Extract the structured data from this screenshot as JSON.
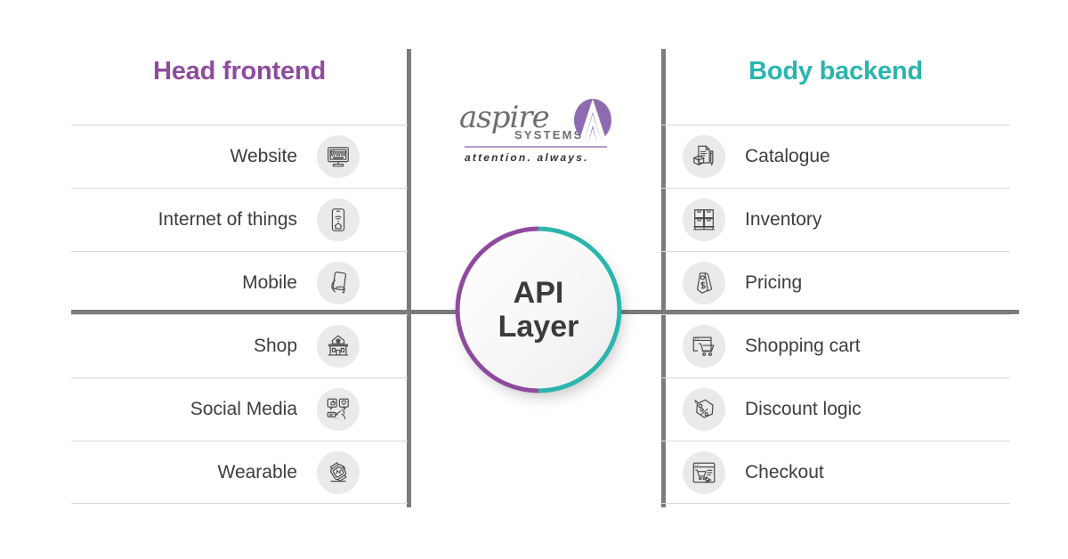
{
  "brand": {
    "logo_word": "aspire",
    "logo_sub": "SYSTEMS",
    "tagline": "attention.  always.",
    "purple": "#8E4B9E",
    "teal": "#2BB5AD",
    "line_gray": "#7b7b7b"
  },
  "center": {
    "title_line1": "API",
    "title_line2": "Layer",
    "ring_left_color": "#8E4B9E",
    "ring_right_color": "#2BB5AD"
  },
  "left_column": {
    "header": "Head frontend",
    "header_color": "#8E4B9E",
    "items": [
      {
        "label": "Website",
        "icon": "monitor-www-icon"
      },
      {
        "label": "Internet of things",
        "icon": "phone-wifi-home-icon"
      },
      {
        "label": "Mobile",
        "icon": "hand-holding-phone-icon"
      },
      {
        "label": "Shop",
        "icon": "storefront-icon"
      },
      {
        "label": "Social Media",
        "icon": "social-reactions-icon"
      },
      {
        "label": "Wearable",
        "icon": "smartwatch-icon"
      }
    ]
  },
  "right_column": {
    "header": "Body backend",
    "header_color": "#2BB5AD",
    "items": [
      {
        "label": "Catalogue",
        "icon": "document-box-pencil-icon"
      },
      {
        "label": "Inventory",
        "icon": "pallet-boxes-icon"
      },
      {
        "label": "Pricing",
        "icon": "price-tag-dollar-icon"
      },
      {
        "label": "Shopping cart",
        "icon": "browser-cart-icon"
      },
      {
        "label": "Discount logic",
        "icon": "tag-percent-icon"
      },
      {
        "label": "Checkout",
        "icon": "browser-checkout-icon"
      }
    ]
  }
}
